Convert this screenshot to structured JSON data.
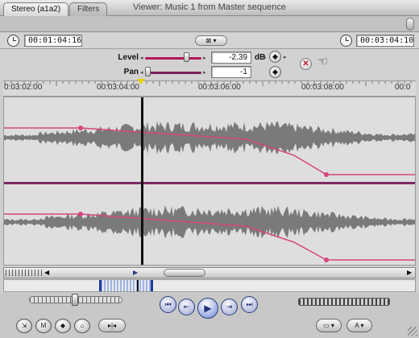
{
  "window": {
    "title": "Viewer: Music 1 from Master sequence"
  },
  "tabs": [
    {
      "label": "Stereo (a1a2)",
      "active": true
    },
    {
      "label": "Filters",
      "active": false
    }
  ],
  "timecode": {
    "duration": "00:01:04:16",
    "current": "00:03:04:10"
  },
  "controls": {
    "level": {
      "label": "Level",
      "value": "-2.39",
      "unit": "dB",
      "slider_fraction": 0.78
    },
    "pan": {
      "label": "Pan",
      "value": "-1",
      "slider_fraction": 0.0
    }
  },
  "ruler": {
    "ticks": [
      "0:03:02:00",
      "00:03:04:00",
      "00:03:06:00",
      "00:03:08:00",
      "00:0"
    ]
  },
  "colors": {
    "waveform": "#7a7a7a",
    "level_line": "#d6457f",
    "separator": "#7b2b63",
    "playhead": "#111111",
    "accent": "#2b3f7a"
  },
  "icons": {
    "close": "circle-icon",
    "minimize": "circle-icon",
    "zoom": "circle-icon",
    "duration_clock": "clock-icon",
    "current_clock": "clock-icon",
    "keyframe": "diamond-icon",
    "reset": "x-icon",
    "drag_hand": "hand-icon",
    "play": "play-icon",
    "prev_edit": "step-back-icon",
    "next_edit": "step-forward-icon",
    "play_in_out": "play-in-out-icon",
    "play_around": "play-around-icon"
  }
}
